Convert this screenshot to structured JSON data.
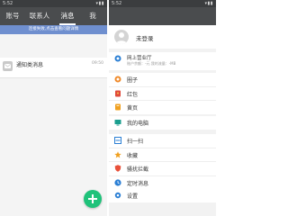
{
  "left": {
    "status_time": "5:52",
    "status_icons": "▾▮▮",
    "tabs": [
      {
        "label": "账号"
      },
      {
        "label": "联系人"
      },
      {
        "label": "消息"
      },
      {
        "label": "我"
      }
    ],
    "notice": "连接失败,点击查看问题详情",
    "message": {
      "title": "通知类消息",
      "time": "09:50"
    }
  },
  "right": {
    "status_time": "5:52",
    "status_icons": "▾▮▮",
    "user": {
      "name": "未登录"
    },
    "account": {
      "title": "网上营业厅",
      "sub": "账户余额：-元  我的流量：-MB"
    },
    "menu_group_1": [
      {
        "label": "圈子",
        "icon": "circle-icon"
      },
      {
        "label": "红包",
        "icon": "red-packet-icon"
      },
      {
        "label": "黄页",
        "icon": "yellow-pages-icon"
      }
    ],
    "menu_group_2": [
      {
        "label": "我的电脑",
        "icon": "computer-icon"
      }
    ],
    "menu_group_3": [
      {
        "label": "扫一扫",
        "icon": "scan-icon"
      },
      {
        "label": "收藏",
        "icon": "star-icon"
      },
      {
        "label": "骚扰拦截",
        "icon": "shield-icon"
      },
      {
        "label": "定时消息",
        "icon": "clock-icon"
      }
    ],
    "menu_group_4": [
      {
        "label": "设置",
        "icon": "gear-icon"
      }
    ]
  },
  "colors": {
    "topbar": "#4a4c4e",
    "notice": "#6f8fcf",
    "fab": "#1fc27a"
  }
}
